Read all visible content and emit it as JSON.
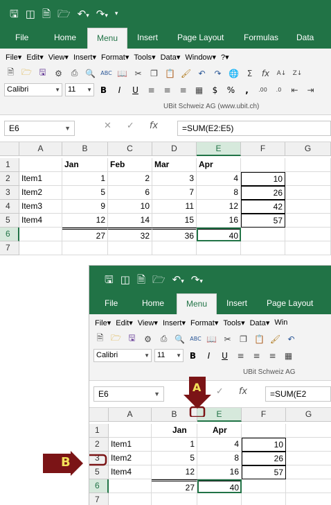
{
  "top": {
    "tabs": [
      "File",
      "Home",
      "Menu",
      "Insert",
      "Page Layout",
      "Formulas",
      "Data"
    ],
    "menubar": [
      "File",
      "Edit",
      "View",
      "Insert",
      "Format",
      "Tools",
      "Data",
      "Window",
      "?"
    ],
    "font_name": "Calibri",
    "font_size": "11",
    "ubit": "UBit Schweiz AG    (www.ubit.ch)",
    "namebox": "E6",
    "formula": "=SUM(E2:E5)",
    "columns": [
      "A",
      "B",
      "C",
      "D",
      "E",
      "F",
      "G"
    ],
    "rows": [
      {
        "n": "1",
        "a": "",
        "b": "Jan",
        "c": "Feb",
        "d": "Mar",
        "e": "Apr",
        "f": ""
      },
      {
        "n": "2",
        "a": "Item1",
        "b": "1",
        "c": "2",
        "d": "3",
        "e": "4",
        "f": "10"
      },
      {
        "n": "3",
        "a": "Item2",
        "b": "5",
        "c": "6",
        "d": "7",
        "e": "8",
        "f": "26"
      },
      {
        "n": "4",
        "a": "Item3",
        "b": "9",
        "c": "10",
        "d": "11",
        "e": "12",
        "f": "42"
      },
      {
        "n": "5",
        "a": "Item4",
        "b": "12",
        "c": "14",
        "d": "15",
        "e": "16",
        "f": "57"
      },
      {
        "n": "6",
        "a": "",
        "b": "27",
        "c": "32",
        "d": "36",
        "e": "40",
        "f": ""
      },
      {
        "n": "7",
        "a": "",
        "b": "",
        "c": "",
        "d": "",
        "e": "",
        "f": ""
      }
    ]
  },
  "bottom": {
    "tabs": [
      "File",
      "Home",
      "Menu",
      "Insert",
      "Page Layout"
    ],
    "menubar": [
      "File",
      "Edit",
      "View",
      "Insert",
      "Format",
      "Tools",
      "Data",
      "Win"
    ],
    "font_name": "Calibri",
    "font_size": "11",
    "ubit": "UBit Schweiz AG",
    "namebox": "E6",
    "formula": "=SUM(E2",
    "columns": [
      "A",
      "B",
      "E",
      "F",
      "G"
    ],
    "rows": [
      {
        "n": "1",
        "a": "",
        "b": "Jan",
        "e": "Apr",
        "f": ""
      },
      {
        "n": "2",
        "a": "Item1",
        "b": "1",
        "e": "4",
        "f": "10"
      },
      {
        "n": "3",
        "a": "Item2",
        "b": "5",
        "e": "8",
        "f": "26"
      },
      {
        "n": "5",
        "a": "Item4",
        "b": "12",
        "e": "16",
        "f": "57"
      },
      {
        "n": "6",
        "a": "",
        "b": "27",
        "e": "40",
        "f": ""
      },
      {
        "n": "7",
        "a": "",
        "b": "",
        "e": "",
        "f": ""
      }
    ],
    "marker_a": "A",
    "marker_b": "B"
  },
  "colors": {
    "excel_green": "#217346",
    "marker_red": "#7b1416",
    "marker_text": "#f3e15a"
  }
}
